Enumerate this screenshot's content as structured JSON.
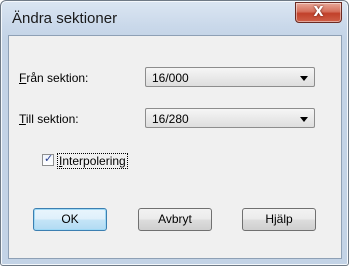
{
  "window": {
    "title": "Ändra sektioner",
    "close_symbol": "X"
  },
  "form": {
    "from_label_accel": "F",
    "from_label_rest": "rån sektion:",
    "from_value": "16/000",
    "to_label_accel": "T",
    "to_label_rest": "ill sektion:",
    "to_value": "16/280",
    "interpolation_accel": "I",
    "interpolation_rest": "nterpolering",
    "interpolation_checked": true
  },
  "buttons": {
    "ok": "OK",
    "cancel": "Avbryt",
    "help": "Hjälp"
  },
  "icons": {
    "close": "close-icon",
    "dropdown": "chevron-down-icon",
    "check": "checkmark-icon"
  },
  "colors": {
    "frame": "#c3d3e6",
    "client": "#f0f0f0",
    "close_button": "#c1402a",
    "default_button_border": "#3c7fb1"
  }
}
